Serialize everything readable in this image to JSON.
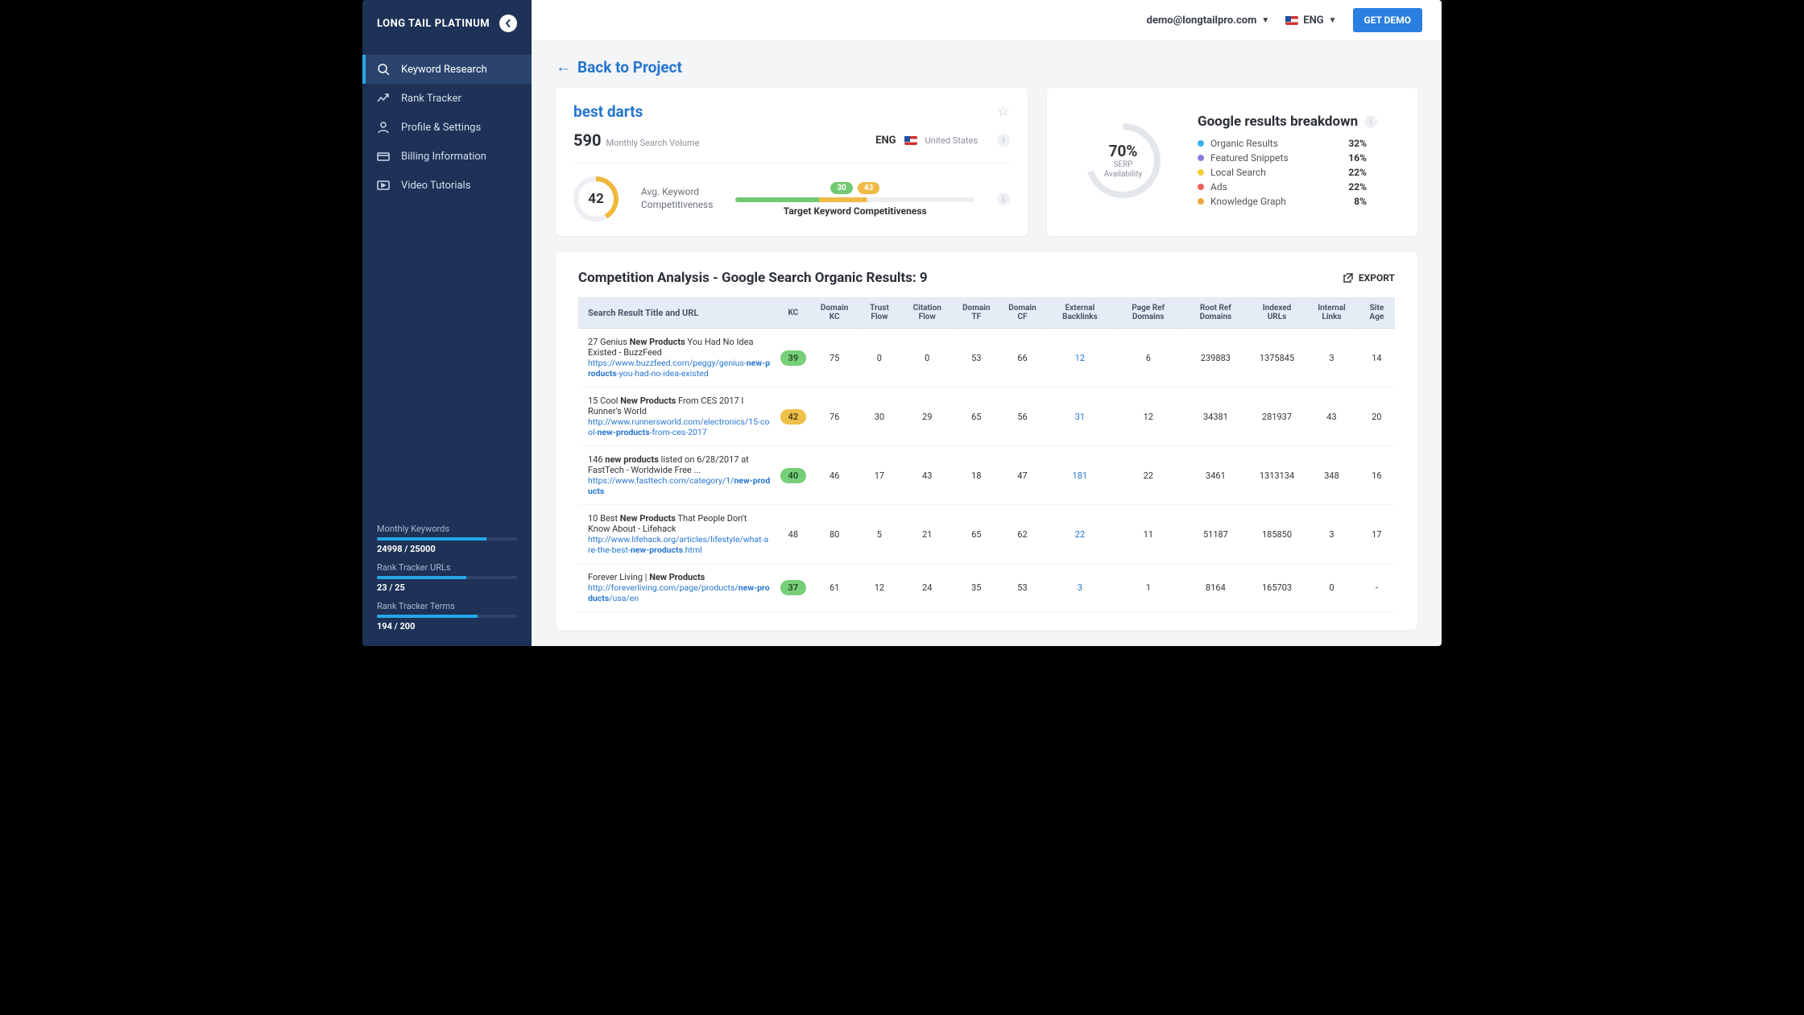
{
  "brand": "LONG TAIL PLATINUM",
  "sidebar": {
    "items": [
      {
        "label": "Keyword Research"
      },
      {
        "label": "Rank Tracker"
      },
      {
        "label": "Profile & Settings"
      },
      {
        "label": "Billing Information"
      },
      {
        "label": "Video Tutorials"
      }
    ],
    "stats": {
      "monthly_keywords_label": "Monthly Keywords",
      "monthly_keywords_val": "24998 / 25000",
      "monthly_keywords_pct": 78,
      "rank_urls_label": "Rank Tracker URLs",
      "rank_urls_val": "23 / 25",
      "rank_urls_pct": 64,
      "rank_terms_label": "Rank Tracker Terms",
      "rank_terms_val": "194 / 200",
      "rank_terms_pct": 72
    }
  },
  "topbar": {
    "user": "demo@longtailpro.com",
    "lang": "ENG",
    "demo_btn": "GET DEMO"
  },
  "back_link": "Back to Project",
  "keyword": {
    "title": "best darts",
    "msv_value": "590",
    "msv_label": "Monthly Search Volume",
    "lang": "ENG",
    "country": "United States",
    "kc_value": "42",
    "kc_label_1": "Avg. Keyword",
    "kc_label_2": "Competitiveness",
    "target_badge_lo": "30",
    "target_badge_hi": "43",
    "target_label": "Target Keyword Competitiveness"
  },
  "serp": {
    "title": "Google results breakdown",
    "pct": "70%",
    "sub1": "SERP",
    "sub2": "Availability",
    "legend": [
      {
        "label": "Organic Results",
        "pct": "32%",
        "color": "#36b4ee"
      },
      {
        "label": "Featured Snippets",
        "pct": "16%",
        "color": "#8a7de0"
      },
      {
        "label": "Local Search",
        "pct": "22%",
        "color": "#f0d03d"
      },
      {
        "label": "Ads",
        "pct": "22%",
        "color": "#f05d5d"
      },
      {
        "label": "Knowledge Graph",
        "pct": "8%",
        "color": "#efa93a"
      }
    ]
  },
  "table": {
    "title": "Competition Analysis - Google Search Organic Results: 9",
    "export": "EXPORT",
    "headers": {
      "title": "Search Result Title and URL",
      "kc": "KC",
      "domain_kc": "Domain KC",
      "trust_flow": "Trust Flow",
      "citation_flow": "Citation Flow",
      "domain_tf": "Domain TF",
      "domain_cf": "Domain CF",
      "ext_backlinks": "External Backlinks",
      "page_ref": "Page Ref Domains",
      "root_ref": "Root Ref Domains",
      "indexed": "Indexed URLs",
      "internal": "Internal Links",
      "age": "Site Age"
    },
    "rows": [
      {
        "title_pre": "27 Genius ",
        "title_bold": "New Products",
        "title_post": " You Had No Idea Existed - BuzzFeed",
        "url_pre": "https://www.buzzfeed.com/peggy/genius-",
        "url_bold": "new-products",
        "url_post": "-you-had-no-idea-existed",
        "kc": "39",
        "kc_style": "green",
        "domain_kc": "75",
        "trust": "0",
        "citation": "0",
        "dtf": "53",
        "dcf": "66",
        "ext": "12",
        "page_ref": "6",
        "root_ref": "239883",
        "indexed": "1375845",
        "internal": "3",
        "age": "14"
      },
      {
        "title_pre": "15 Cool ",
        "title_bold": "New Products",
        "title_post": " From CES 2017 I Runner's World",
        "url_pre": "http://www.runnersworld.com/electronics/15-cool-",
        "url_bold": "new-products",
        "url_post": "-from-ces-2017",
        "kc": "42",
        "kc_style": "amber",
        "domain_kc": "76",
        "trust": "30",
        "citation": "29",
        "dtf": "65",
        "dcf": "56",
        "ext": "31",
        "page_ref": "12",
        "root_ref": "34381",
        "indexed": "281937",
        "internal": "43",
        "age": "20"
      },
      {
        "title_pre": "146 ",
        "title_bold": "new products",
        "title_post": " listed on 6/28/2017 at FastTech - Worldwide Free ...",
        "url_pre": "https://www.fasttech.com/category/1/",
        "url_bold": "new-products",
        "url_post": "",
        "kc": "40",
        "kc_style": "green",
        "domain_kc": "46",
        "trust": "17",
        "citation": "43",
        "dtf": "18",
        "dcf": "47",
        "ext": "181",
        "page_ref": "22",
        "root_ref": "3461",
        "indexed": "1313134",
        "internal": "348",
        "age": "16"
      },
      {
        "title_pre": "10 Best ",
        "title_bold": "New Products",
        "title_post": " That People Don't Know About - Lifehack",
        "url_pre": "http://www.lifehack.org/articles/lifestyle/what-are-the-best-",
        "url_bold": "new-products",
        "url_post": ".html",
        "kc": "48",
        "kc_style": "none",
        "domain_kc": "80",
        "trust": "5",
        "citation": "21",
        "dtf": "65",
        "dcf": "62",
        "ext": "22",
        "page_ref": "11",
        "root_ref": "51187",
        "indexed": "185850",
        "internal": "3",
        "age": "17"
      },
      {
        "title_pre": "Forever Living | ",
        "title_bold": "New Products",
        "title_post": "",
        "url_pre": "http://foreverliving.com/page/products/",
        "url_bold": "new-products",
        "url_post": "/usa/en",
        "kc": "37",
        "kc_style": "green",
        "domain_kc": "61",
        "trust": "12",
        "citation": "24",
        "dtf": "35",
        "dcf": "53",
        "ext": "3",
        "page_ref": "1",
        "root_ref": "8164",
        "indexed": "165703",
        "internal": "0",
        "age": "-"
      }
    ]
  },
  "chart_data": [
    {
      "type": "pie",
      "title": "Google results breakdown",
      "center_value": 70,
      "center_label": "SERP Availability",
      "series": [
        {
          "name": "Organic Results",
          "value": 32
        },
        {
          "name": "Featured Snippets",
          "value": 16
        },
        {
          "name": "Local Search",
          "value": 22
        },
        {
          "name": "Ads",
          "value": 22
        },
        {
          "name": "Knowledge Graph",
          "value": 8
        }
      ]
    }
  ]
}
